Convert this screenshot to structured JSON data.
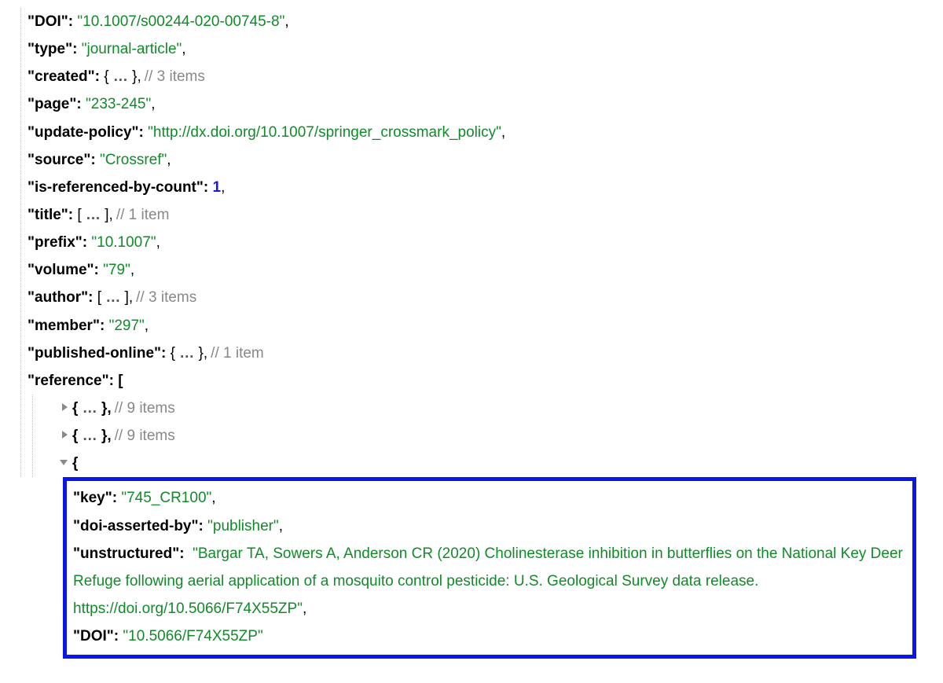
{
  "entries": {
    "doi": {
      "key": "DOI",
      "value": "10.1007/s00244-020-00745-8"
    },
    "type": {
      "key": "type",
      "value": "journal-article"
    },
    "created": {
      "key": "created",
      "comment": "3 items"
    },
    "page": {
      "key": "page",
      "value": "233-245"
    },
    "updatePolicy": {
      "key": "update-policy",
      "value": "http://dx.doi.org/10.1007/springer_crossmark_policy"
    },
    "source": {
      "key": "source",
      "value": "Crossref"
    },
    "refByCount": {
      "key": "is-referenced-by-count",
      "value": "1"
    },
    "title": {
      "key": "title",
      "comment": "1 item"
    },
    "prefix": {
      "key": "prefix",
      "value": "10.1007"
    },
    "volume": {
      "key": "volume",
      "value": "79"
    },
    "author": {
      "key": "author",
      "comment": "3 items"
    },
    "member": {
      "key": "member",
      "value": "297"
    },
    "pubOnline": {
      "key": "published-online",
      "comment": "1 item"
    },
    "reference": {
      "key": "reference"
    },
    "refItem": {
      "comment": "9 items"
    }
  },
  "refDetail": {
    "key": {
      "key": "key",
      "value": "745_CR100"
    },
    "doiAssertedBy": {
      "key": "doi-asserted-by",
      "value": "publisher"
    },
    "unstructured": {
      "key": "unstructured",
      "value": "Bargar TA, Sowers A, Anderson CR (2020) Cholinesterase inhibition in butterflies on the National Key Deer Refuge following aerial application of a mosquito control pesticide: U.S. Geological Survey data release. https://doi.org/10.5066/F74X55ZP"
    },
    "doi": {
      "key": "DOI",
      "value": "10.5066/F74X55ZP"
    }
  },
  "glyphs": {
    "ellipsis": "…",
    "commentPrefix": "// "
  }
}
